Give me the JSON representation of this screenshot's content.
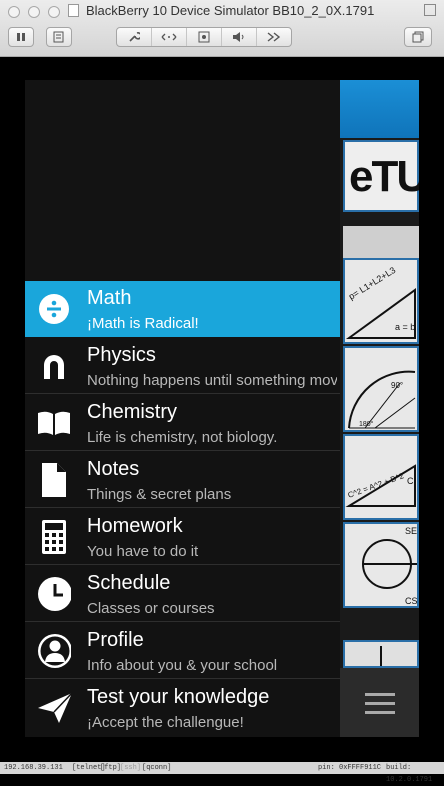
{
  "window": {
    "title": "BlackBerry 10 Device Simulator BB10_2_0X.1791"
  },
  "toolbar": {
    "icons": [
      "pause-icon",
      "log-icon",
      "wrench-icon",
      "arrows-icon",
      "screenshot-icon",
      "speaker-icon",
      "forward-icon",
      "fullscreen-icon"
    ]
  },
  "menu": {
    "items": [
      {
        "title": "Math",
        "subtitle": "¡Math is Radical!",
        "icon": "divide-icon",
        "active": true
      },
      {
        "title": "Physics",
        "subtitle": "Nothing happens until something moves.",
        "icon": "magnet-icon"
      },
      {
        "title": "Chemistry",
        "subtitle": "Life is chemistry, not biology.",
        "icon": "book-icon"
      },
      {
        "title": "Notes",
        "subtitle": "Things & secret plans",
        "icon": "note-icon"
      },
      {
        "title": "Homework",
        "subtitle": "You have to do it",
        "icon": "calculator-icon"
      },
      {
        "title": "Schedule",
        "subtitle": "Classes or courses",
        "icon": "clock-icon"
      },
      {
        "title": "Profile",
        "subtitle": "Info about you & your school",
        "icon": "person-icon"
      },
      {
        "title": "Test your knowledge",
        "subtitle": "¡Accept the challengue!",
        "icon": "paper-plane-icon"
      }
    ]
  },
  "panel": {
    "logo_text": "eTU",
    "formulas": [
      "p= L1+L2+L3",
      "a = b",
      "90°",
      "180°",
      "C^2 = A^2 + B^2",
      "C",
      "SE",
      "CS"
    ]
  },
  "statusbar": {
    "ip": "192.168.39.131",
    "telnet": "[telnet]",
    "ftp": "[ftp]",
    "ssh": "[ssh]",
    "qconn": "[qconn]",
    "pin": "pin: 0xFFFF911C",
    "build": "build: 10.2.0.1791"
  },
  "colors": {
    "accent": "#1aa6db",
    "menu_bg": "#121212",
    "panel_header": "#1b8fd6"
  }
}
